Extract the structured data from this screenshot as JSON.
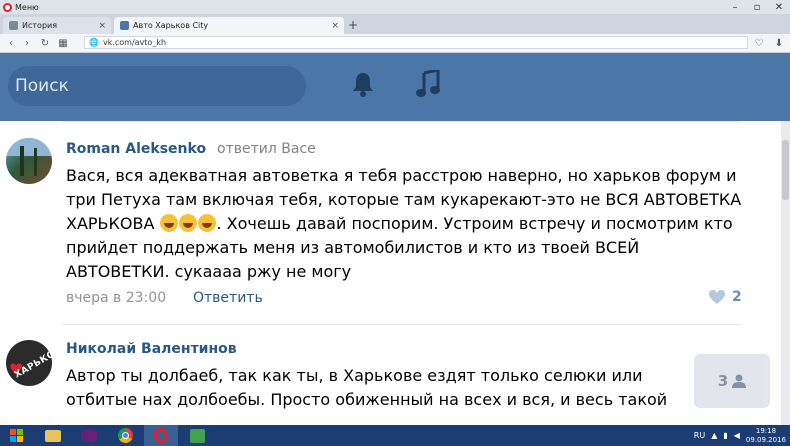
{
  "browser": {
    "menu_label": "Меню",
    "tabs": [
      {
        "label": "История"
      },
      {
        "label": "Авто Харьков City"
      }
    ],
    "url": "vk.com/avto_kh"
  },
  "vk": {
    "search_placeholder": "Поиск"
  },
  "comments": [
    {
      "author": "Roman Aleksenko",
      "replied_to": "ответил Васе",
      "text_part1": "Вася, вся адекватная автоветка я тебя расстрою наверно, но харьков форум и три Петуха там включая тебя, которые там кукарекают-это не ВСЯ АВТОВЕТКА ХАРЬКОВА ",
      "text_part2": ". Хочешь давай поспорим. Устроим встречу и посмотрим кто прийдет поддержать меня из автомобилистов и кто из твоей ВСЕЙ АВТОВЕТКИ. сукаааа ржу не могу",
      "time": "вчера в 23:00",
      "reply_label": "Ответить",
      "likes": "2"
    },
    {
      "author": "Николай Валентинов",
      "text": "Автор ты долбаеб, так как ты, в Харькове ездят только селюки или отбитые нах долбоебы. Просто обиженный на всех и вся, и весь такой"
    }
  ],
  "floating_badge": {
    "count": "3"
  },
  "taskbar": {
    "lang": "RU",
    "time": "19:18",
    "date": "09.09.2016"
  },
  "colors": {
    "vk_header": "#4a76a8",
    "link": "#2a5885",
    "taskbar": "#1b3d73"
  }
}
